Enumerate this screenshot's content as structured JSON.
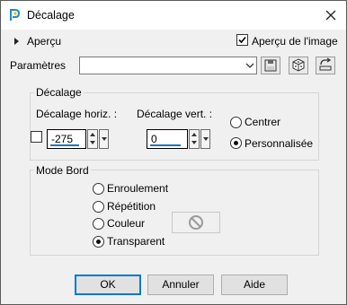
{
  "window": {
    "title": "Décalage",
    "app_icon": "paintshop-icon",
    "close_icon": "close-icon"
  },
  "preview": {
    "label": "Aperçu",
    "expanded": false
  },
  "image_preview": {
    "label": "Aperçu de l'image",
    "checked": true
  },
  "params": {
    "label": "Paramètres",
    "value": "",
    "icons": [
      "save-icon",
      "dice-icon",
      "reset-icon"
    ]
  },
  "offset_group": {
    "title": "Décalage",
    "horiz_label": "Décalage horiz. :",
    "horiz_value": "-275",
    "vert_label": "Décalage vert. :",
    "vert_value": "0",
    "link_checked": false,
    "centrer_label": "Centrer",
    "perso_label": "Personnalisée",
    "selected": "Personnalisée"
  },
  "edge_group": {
    "title": "Mode Bord",
    "options": [
      "Enroulement",
      "Répétition",
      "Couleur",
      "Transparent"
    ],
    "selected": "Transparent",
    "color_icon": "no-color-icon"
  },
  "buttons": {
    "ok": "OK",
    "cancel": "Annuler",
    "help": "Aide"
  }
}
